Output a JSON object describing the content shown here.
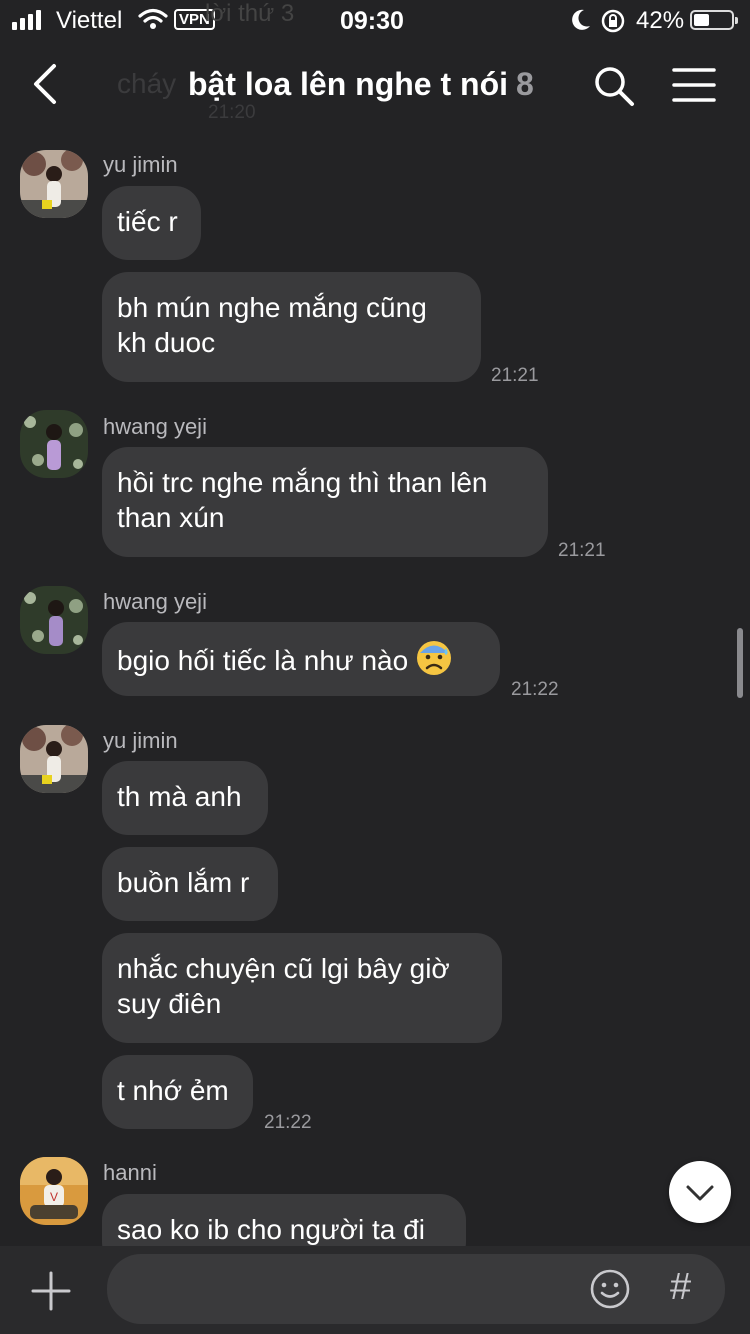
{
  "status": {
    "carrier": "Viettel",
    "vpn": "VPN",
    "time": "09:30",
    "battery": "42%"
  },
  "header": {
    "title": "bật loa lên nghe t nói",
    "member_count": "8",
    "ghost_prev_line": "lời thứ 3",
    "ghost_prev_text": "cháy",
    "ghost_prev_time": "21:20"
  },
  "messages": [
    {
      "sender": "yu jimin",
      "bubbles": [
        "tiếc r",
        "bh mún nghe mắng cũng\nkh duoc"
      ],
      "time": "21:21"
    },
    {
      "sender": "hwang yeji",
      "bubbles": [
        "hồi trc nghe mắng thì than lên\nthan xún"
      ],
      "time": "21:21"
    },
    {
      "sender": "hwang yeji",
      "bubbles": [
        "bgio hối tiếc là như nào"
      ],
      "emoji": "anxious-face-with-sweat",
      "time": "21:22"
    },
    {
      "sender": "yu jimin",
      "bubbles": [
        "th mà anh",
        "buồn lắm r",
        "nhắc chuyện cũ lgi bây giờ\nsuy điên",
        "t nhớ ẻm"
      ],
      "time": "21:22"
    },
    {
      "sender": "hanni",
      "bubbles": [
        "sao ko ib cho người ta đi"
      ]
    }
  ],
  "input": {
    "placeholder": "",
    "value": ""
  },
  "icons": {
    "back": "chevron-left-icon",
    "search": "search-icon",
    "menu": "hamburger-menu-icon",
    "scroll_down": "chevron-down-icon",
    "attach": "plus-icon",
    "emoji": "smile-icon",
    "hashtag": "#"
  }
}
